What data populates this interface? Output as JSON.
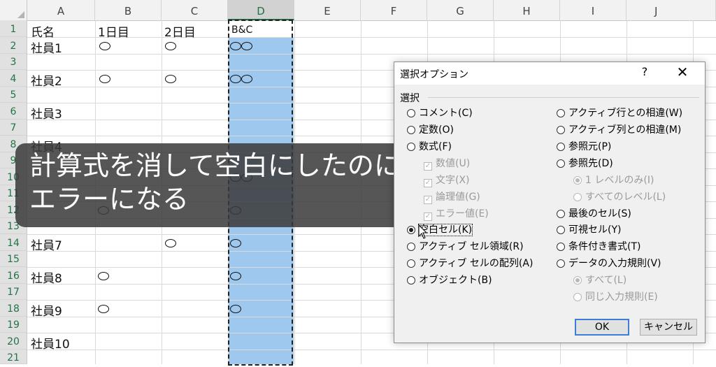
{
  "columns": [
    "A",
    "B",
    "C",
    "D",
    "E",
    "F",
    "G",
    "H",
    "I",
    "J"
  ],
  "rows": [
    "1",
    "2",
    "3",
    "4",
    "5",
    "6",
    "7",
    "8",
    "9",
    "10",
    "11",
    "12",
    "13",
    "14",
    "15",
    "16",
    "17",
    "18",
    "19",
    "20",
    "21"
  ],
  "cells": {
    "a1": "氏名",
    "b1": "1日目",
    "c1": "2日目",
    "d1": "B&C",
    "a2": "社員1",
    "a4": "社員2",
    "a6": "社員3",
    "a8": "社員4",
    "a14": "社員7",
    "a16": "社員8",
    "a18": "社員9",
    "a20": "社員10"
  },
  "overlay_caption": {
    "line1": "計算式を消して空白にしたのに",
    "line2": "エラーになる"
  },
  "dialog": {
    "title": "選択オプション",
    "help": "?",
    "close": "✕",
    "group_label": "選択",
    "left_options": [
      {
        "label": "コメント(C)"
      },
      {
        "label": "定数(O)"
      },
      {
        "label": "数式(F)"
      },
      {
        "label": "数値(U)"
      },
      {
        "label": "文字(X)"
      },
      {
        "label": "論理値(G)"
      },
      {
        "label": "エラー値(E)"
      },
      {
        "label": "空白セル(K)"
      },
      {
        "label": "アクティブ セル領域(R)"
      },
      {
        "label": "アクティブ セルの配列(A)"
      },
      {
        "label": "オブジェクト(B)"
      }
    ],
    "right_options": [
      {
        "label": "アクティブ行との相違(W)"
      },
      {
        "label": "アクティブ列との相違(M)"
      },
      {
        "label": "参照元(P)"
      },
      {
        "label": "参照先(D)"
      },
      {
        "label": "1 レベルのみ(I)"
      },
      {
        "label": "すべてのレベル(L)"
      },
      {
        "label": "最後のセル(S)"
      },
      {
        "label": "可視セル(Y)"
      },
      {
        "label": "条件付き書式(T)"
      },
      {
        "label": "データの入力規則(V)"
      },
      {
        "label": "すべて(L)"
      },
      {
        "label": "同じ入力規則(E)"
      }
    ],
    "selected": "空白セル(K)",
    "ok_label": "OK",
    "cancel_label": "キャンセル"
  }
}
